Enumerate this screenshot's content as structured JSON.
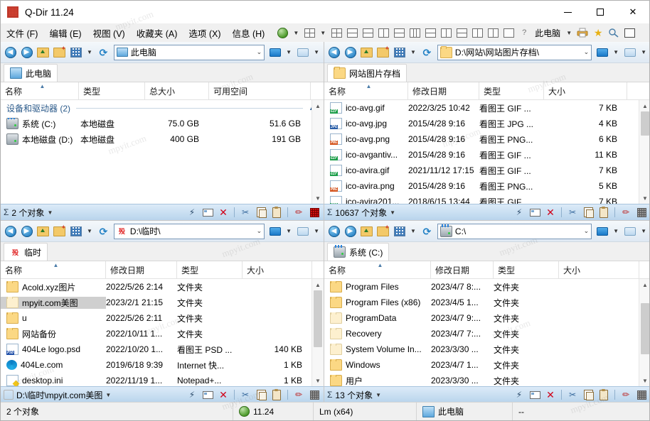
{
  "window": {
    "title": "Q-Dir 11.24",
    "app_icon": "app-icon",
    "minimize": "—",
    "maximize": "□",
    "close": "✕"
  },
  "menubar": {
    "items": [
      "文件 (F)",
      "编辑 (E)",
      "视图 (V)",
      "收藏夹 (A)",
      "选项 (X)",
      "信息 (H)"
    ],
    "globe_icon": "globe-icon",
    "layout_icon": "layout-grid-icon",
    "layout_buttons": [
      "layout-1",
      "layout-2",
      "layout-3",
      "layout-4",
      "layout-5",
      "layout-6",
      "layout-7",
      "layout-8",
      "layout-9",
      "layout-10",
      "layout-11",
      "layout-12"
    ],
    "help_icon": "help-inet-icon",
    "target_label": "此电脑",
    "printer_icon": "printer-icon",
    "favorite_icon": "star-favorite-icon",
    "zoom_icon": "zoom-icon",
    "window_icon": "window-restore-icon"
  },
  "panels": [
    {
      "id": "top-left",
      "address": "此电脑",
      "address_icon": "this-pc-icon",
      "tab": {
        "label": "此电脑",
        "icon": "this-pc-icon"
      },
      "columns": [
        "名称",
        "类型",
        "总大小",
        "可用空间"
      ],
      "sort_indicator": "^",
      "group": {
        "label": "设备和驱动器 (2)",
        "chevron": "^"
      },
      "rows": [
        {
          "icon": "drive-system-icon",
          "name": "系统 (C:)",
          "type": "本地磁盘",
          "total": "75.0 GB",
          "free": "51.6 GB",
          "selected": false
        },
        {
          "icon": "drive-icon",
          "name": "本地磁盘 (D:)",
          "type": "本地磁盘",
          "total": "400 GB",
          "free": "191 GB",
          "selected": false
        }
      ],
      "status": {
        "count": "2 个对象",
        "sigma": "Σ"
      }
    },
    {
      "id": "top-right",
      "address": "D:\\网站\\网站图片存档\\",
      "address_icon": "folder-icon",
      "tab": {
        "label": "网站图片存档",
        "icon": "folder-icon"
      },
      "columns": [
        "名称",
        "修改日期",
        "类型",
        "大小"
      ],
      "sort_indicator": "^",
      "rows": [
        {
          "icon": "gif-file-icon",
          "badge": "GIF",
          "name": "ico-avg.gif",
          "date": "2022/3/25 10:42",
          "type": "看图王 GIF ...",
          "size": "7 KB"
        },
        {
          "icon": "jpg-file-icon",
          "badge": "JPG",
          "name": "ico-avg.jpg",
          "date": "2015/4/28 9:16",
          "type": "看图王 JPG ...",
          "size": "4 KB"
        },
        {
          "icon": "png-file-icon",
          "badge": "PNG",
          "name": "ico-avg.png",
          "date": "2015/4/28 9:16",
          "type": "看图王 PNG...",
          "size": "6 KB"
        },
        {
          "icon": "gif-file-icon",
          "badge": "GIF",
          "name": "ico-avgantiv...",
          "date": "2015/4/28 9:16",
          "type": "看图王 GIF ...",
          "size": "11 KB"
        },
        {
          "icon": "gif-file-icon",
          "badge": "GIF",
          "name": "ico-avira.gif",
          "date": "2021/11/12 17:15",
          "type": "看图王 GIF ...",
          "size": "7 KB"
        },
        {
          "icon": "png-file-icon",
          "badge": "PNG",
          "name": "ico-avira.png",
          "date": "2015/4/28 9:16",
          "type": "看图王 PNG...",
          "size": "5 KB"
        },
        {
          "icon": "gif-file-icon",
          "badge": "GIF",
          "name": "ico-avira201...",
          "date": "2018/6/15 13:44",
          "type": "看图王 GIF ...",
          "size": "7 KB"
        }
      ],
      "status": {
        "count": "10637 个对象",
        "sigma": "Σ"
      }
    },
    {
      "id": "bottom-left",
      "address": "D:\\临时\\",
      "address_icon": "red-char-icon",
      "address_icon_text": "殁",
      "tab": {
        "label": "临时",
        "icon": "red-char-icon",
        "icon_text": "殁"
      },
      "columns": [
        "名称",
        "修改日期",
        "类型",
        "大小"
      ],
      "sort_indicator": "^",
      "rows": [
        {
          "icon": "folder-icon",
          "name": "Acold.xyz图片",
          "date": "2022/5/26 2:14",
          "type": "文件夹",
          "size": "",
          "selected": false
        },
        {
          "icon": "folder-pale-icon",
          "name": "mpyit.com美图",
          "date": "2023/2/1 21:15",
          "type": "文件夹",
          "size": "",
          "selected": true
        },
        {
          "icon": "folder-icon",
          "name": "u",
          "date": "2022/5/26 2:11",
          "type": "文件夹",
          "size": "",
          "selected": false
        },
        {
          "icon": "folder-icon",
          "name": "网站备份",
          "date": "2022/10/11 1...",
          "type": "文件夹",
          "size": "",
          "selected": false
        },
        {
          "icon": "psd-file-icon",
          "badge": "PSD",
          "name": "404Le logo.psd",
          "date": "2022/10/20 1...",
          "type": "看图王 PSD ...",
          "size": "140 KB",
          "selected": false
        },
        {
          "icon": "edge-browser-icon",
          "name": "404Le.com",
          "date": "2019/6/18 9:39",
          "type": "Internet 快...",
          "size": "1 KB",
          "selected": false
        },
        {
          "icon": "ini-file-icon",
          "name": "desktop.ini",
          "date": "2022/11/19 1...",
          "type": "Notepad+...",
          "size": "1 KB",
          "selected": false
        }
      ],
      "status": {
        "count": "D:\\临时\\mpyit.com美图",
        "sigma": ""
      }
    },
    {
      "id": "bottom-right",
      "address": "C:\\",
      "address_icon": "drive-system-icon",
      "tab": {
        "label": "系统 (C:)",
        "icon": "drive-system-icon"
      },
      "columns": [
        "名称",
        "修改日期",
        "类型",
        "大小"
      ],
      "sort_indicator": "^",
      "rows": [
        {
          "icon": "folder-icon",
          "name": "Program Files",
          "date": "2023/4/7 8:...",
          "type": "文件夹",
          "size": ""
        },
        {
          "icon": "folder-icon",
          "name": "Program Files (x86)",
          "date": "2023/4/5 1...",
          "type": "文件夹",
          "size": ""
        },
        {
          "icon": "folder-pale-icon",
          "name": "ProgramData",
          "date": "2023/4/7 9:...",
          "type": "文件夹",
          "size": ""
        },
        {
          "icon": "folder-pale-icon",
          "name": "Recovery",
          "date": "2023/4/7 7:...",
          "type": "文件夹",
          "size": ""
        },
        {
          "icon": "folder-pale-icon",
          "name": "System Volume In...",
          "date": "2023/3/30 ...",
          "type": "文件夹",
          "size": ""
        },
        {
          "icon": "folder-icon",
          "name": "Windows",
          "date": "2023/4/7 1...",
          "type": "文件夹",
          "size": ""
        },
        {
          "icon": "folder-icon",
          "name": "用户",
          "date": "2023/3/30 ...",
          "type": "文件夹",
          "size": ""
        }
      ],
      "status": {
        "count": "13 个对象",
        "sigma": "Σ"
      }
    }
  ],
  "panel_toolbar": {
    "back": "back-button",
    "forward": "forward-button",
    "up": "up-folder-button",
    "new_folder": "new-folder-button",
    "views": "view-options-button",
    "refresh": "refresh-button",
    "monitor1": "panel-view-button",
    "monitor2": "panel-split-button"
  },
  "status_icons": {
    "bolt": "flash-icon",
    "rename": "rename-icon",
    "delete": "delete-icon",
    "cut": "cut-icon",
    "copy": "copy-icon",
    "paste": "paste-icon",
    "edit": "edit-pen-icon",
    "grid": "grid-icon"
  },
  "statusbar": {
    "objects": "2 个对象",
    "version": "11.24",
    "version_icon": "globe-icon",
    "build": "Lm (x64)",
    "location": "此电脑",
    "location_icon": "this-pc-icon",
    "extra": "--"
  },
  "watermarks": [
    "mpyit.com",
    "mpyit.com",
    "mpyit.com",
    "mpyit.com",
    "mpyit.com",
    "mpyit.com",
    "mpyit.com",
    "mpyit.com",
    "mpyit.com",
    "mpyit.com",
    "mpyit.com",
    "mpyit.com"
  ],
  "colors": {
    "accent": "#2d86c7",
    "selection": "#cfcfcf",
    "group_text": "#2b5a8a",
    "delete_red": "#d0021b"
  }
}
